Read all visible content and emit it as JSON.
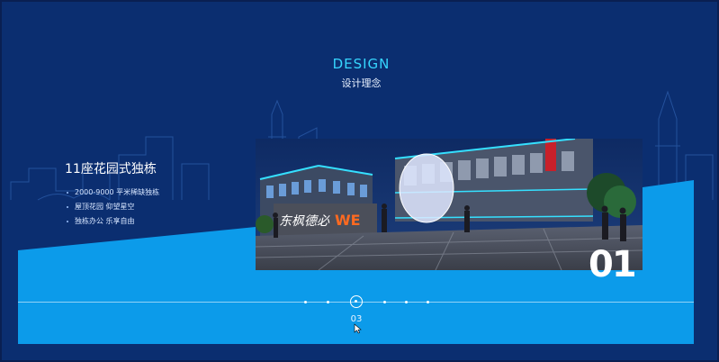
{
  "header": {
    "title_en": "DESIGN",
    "title_zh": "设计理念"
  },
  "feature": {
    "title": "11座花园式独栋",
    "items": [
      "2000-9000 平米稀缺独栋",
      "屋顶花园 仰望星空",
      "独栋办公 乐享自由"
    ]
  },
  "slide": {
    "big_number": "01",
    "photo_signage": [
      "东枫德必",
      "WE"
    ]
  },
  "timeline": {
    "current_page": "03"
  },
  "colors": {
    "background": "#0b2e70",
    "band": "#0c9bea",
    "accent": "#36d6ff"
  }
}
